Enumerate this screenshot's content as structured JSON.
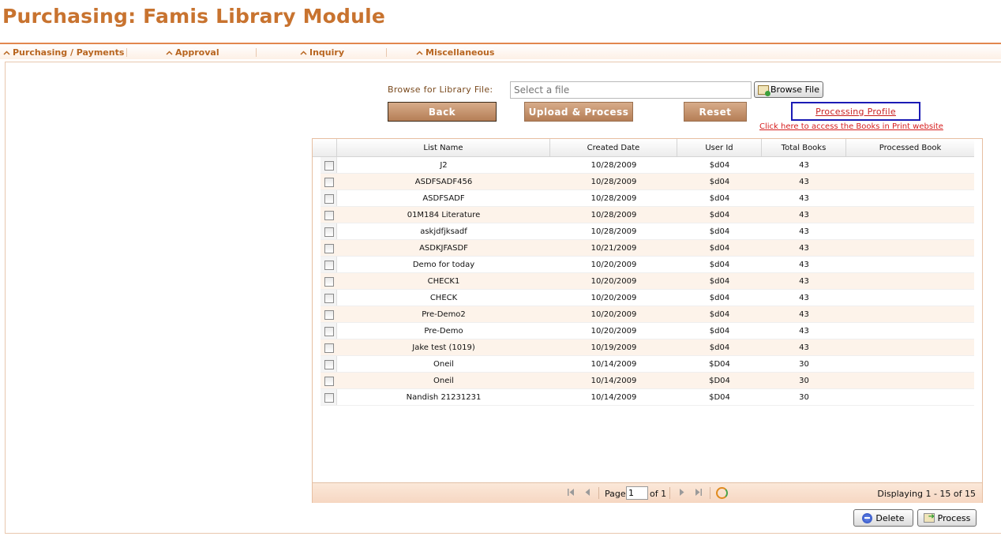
{
  "app": {
    "title": "Purchasing: Famis Library Module"
  },
  "menu": [
    {
      "label": "Purchasing / Payments"
    },
    {
      "label": "Approval"
    },
    {
      "label": "Inquiry"
    },
    {
      "label": "Miscellaneous"
    }
  ],
  "upload": {
    "browse_label": "Browse for Library File:",
    "file_placeholder": "Select a file",
    "browse_button": "Browse File",
    "back_button": "Back",
    "upload_button": "Upload & Process",
    "reset_button": "Reset",
    "profile_link": "Processing Profile",
    "bip_link": "Click here to access the Books in Print website"
  },
  "grid": {
    "columns": [
      "List Name",
      "Created Date",
      "User Id",
      "Total Books",
      "Processed Book"
    ],
    "rows": [
      {
        "name": "J2",
        "date": "10/28/2009",
        "user": "$d04",
        "total": "43",
        "processed": ""
      },
      {
        "name": "ASDFSADF456",
        "date": "10/28/2009",
        "user": "$d04",
        "total": "43",
        "processed": ""
      },
      {
        "name": "ASDFSADF",
        "date": "10/28/2009",
        "user": "$d04",
        "total": "43",
        "processed": ""
      },
      {
        "name": "01M184 Literature",
        "date": "10/28/2009",
        "user": "$d04",
        "total": "43",
        "processed": ""
      },
      {
        "name": "askjdfjksadf",
        "date": "10/28/2009",
        "user": "$d04",
        "total": "43",
        "processed": ""
      },
      {
        "name": "ASDKJFASDF",
        "date": "10/21/2009",
        "user": "$d04",
        "total": "43",
        "processed": ""
      },
      {
        "name": "Demo for today",
        "date": "10/20/2009",
        "user": "$d04",
        "total": "43",
        "processed": ""
      },
      {
        "name": "CHECK1",
        "date": "10/20/2009",
        "user": "$d04",
        "total": "43",
        "processed": ""
      },
      {
        "name": "CHECK",
        "date": "10/20/2009",
        "user": "$d04",
        "total": "43",
        "processed": ""
      },
      {
        "name": "Pre-Demo2",
        "date": "10/20/2009",
        "user": "$d04",
        "total": "43",
        "processed": ""
      },
      {
        "name": "Pre-Demo",
        "date": "10/20/2009",
        "user": "$d04",
        "total": "43",
        "processed": ""
      },
      {
        "name": "Jake test (1019)",
        "date": "10/19/2009",
        "user": "$d04",
        "total": "43",
        "processed": ""
      },
      {
        "name": "Oneil",
        "date": "10/14/2009",
        "user": "$D04",
        "total": "30",
        "processed": ""
      },
      {
        "name": "Oneil",
        "date": "10/14/2009",
        "user": "$D04",
        "total": "30",
        "processed": ""
      },
      {
        "name": "Nandish 21231231",
        "date": "10/14/2009",
        "user": "$D04",
        "total": "30",
        "processed": ""
      }
    ]
  },
  "pager": {
    "page_label": "Page",
    "page_value": "1",
    "of_label": "of 1",
    "display": "Displaying 1 - 15 of 15"
  },
  "actions": {
    "delete_button": "Delete",
    "process_button": "Process"
  },
  "colors": {
    "accent": "#c8732f",
    "button_brown": "#b57e56",
    "link_red": "#d61d1d",
    "row_alt": "#fdf3ea"
  }
}
